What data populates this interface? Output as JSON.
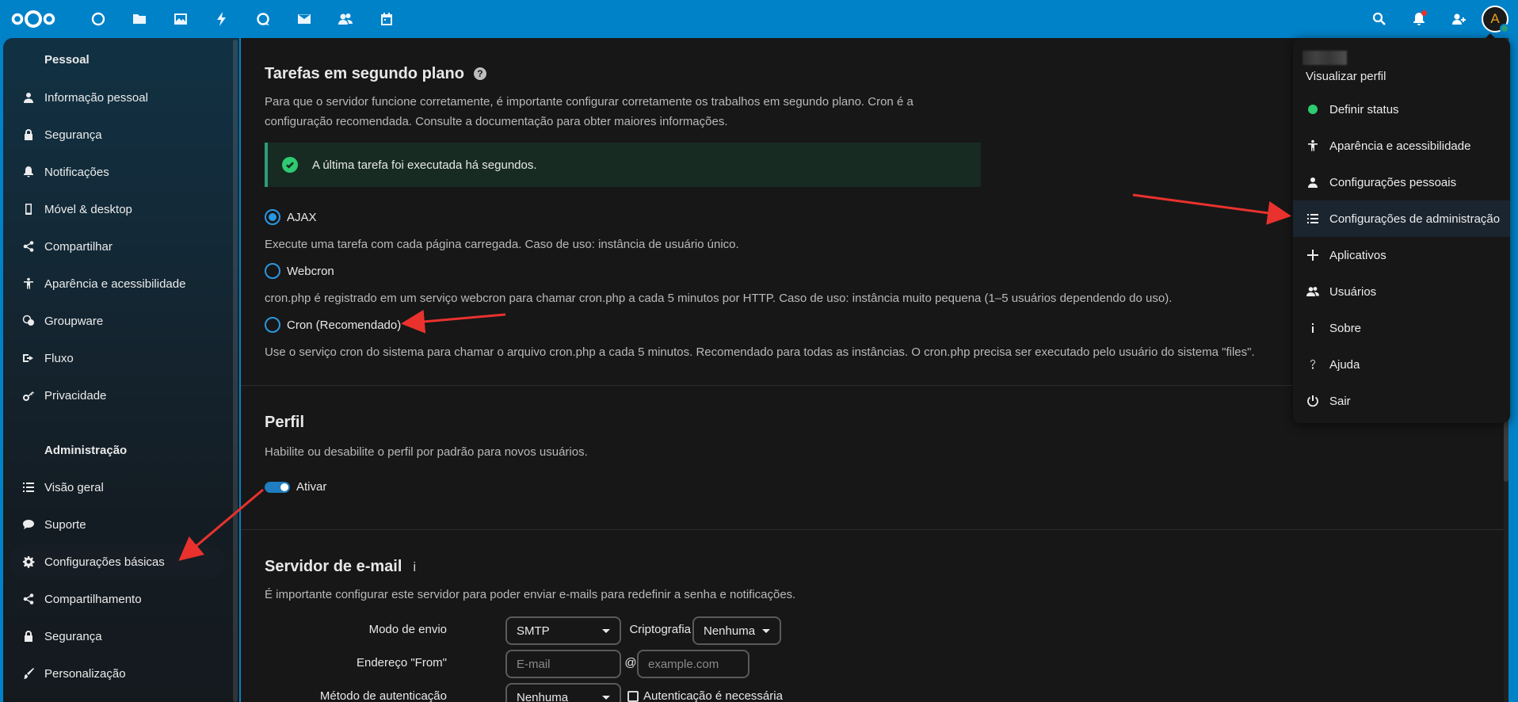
{
  "header": {
    "app_icons": [
      "dashboard-icon",
      "files-icon",
      "photos-icon",
      "activity-icon",
      "talk-icon",
      "mail-icon",
      "contacts-icon",
      "calendar-icon"
    ],
    "avatar_letter": "A"
  },
  "sidebar": {
    "personal_title": "Pessoal",
    "personal_items": [
      {
        "label": "Informação pessoal",
        "icon": "user-icon"
      },
      {
        "label": "Segurança",
        "icon": "lock-icon"
      },
      {
        "label": "Notificações",
        "icon": "bell-icon"
      },
      {
        "label": "Móvel & desktop",
        "icon": "phone-icon"
      },
      {
        "label": "Compartilhar",
        "icon": "share-icon"
      },
      {
        "label": "Aparência e acessibilidade",
        "icon": "accessibility-icon"
      },
      {
        "label": "Groupware",
        "icon": "groupware-icon"
      },
      {
        "label": "Fluxo",
        "icon": "flow-icon"
      },
      {
        "label": "Privacidade",
        "icon": "key-icon"
      }
    ],
    "admin_title": "Administração",
    "admin_items": [
      {
        "label": "Visão geral",
        "icon": "list-icon"
      },
      {
        "label": "Suporte",
        "icon": "chat-icon"
      },
      {
        "label": "Configurações básicas",
        "icon": "gear-icon",
        "active": true
      },
      {
        "label": "Compartilhamento",
        "icon": "share-icon"
      },
      {
        "label": "Segurança",
        "icon": "lock-icon"
      },
      {
        "label": "Personalização",
        "icon": "brush-icon"
      }
    ]
  },
  "background_jobs": {
    "title": "Tarefas em segundo plano",
    "description_line1": "Para que o servidor funcione corretamente, é importante configurar corretamente os trabalhos em segundo plano. Cron é a",
    "description_line2": "configuração recomendada. Consulte a documentação para obter maiores informações.",
    "status_message": "A última tarefa foi executada há segundos.",
    "options": [
      {
        "label": "AJAX",
        "checked": true,
        "description": "Execute uma tarefa com cada página carregada. Caso de uso: instância de usuário único."
      },
      {
        "label": "Webcron",
        "checked": false,
        "description": "cron.php é registrado em um serviço webcron para chamar cron.php a cada 5 minutos por HTTP. Caso de uso: instância muito pequena (1–5 usuários dependendo do uso)."
      },
      {
        "label": "Cron (Recomendado)",
        "checked": false,
        "description": "Use o serviço cron do sistema para chamar o arquivo cron.php a cada 5 minutos. Recomendado para todas as instâncias. O cron.php precisa ser executado pelo usuário do sistema \"files\"."
      }
    ]
  },
  "profile": {
    "title": "Perfil",
    "description": "Habilite ou desabilite o perfil por padrão para novos usuários.",
    "toggle_label": "Ativar",
    "enabled": true
  },
  "email": {
    "title": "Servidor de e-mail",
    "info": "i",
    "description": "É importante configurar este servidor para poder enviar e-mails para redefinir a senha e notificações.",
    "send_mode_label": "Modo de envio",
    "send_mode_value": "SMTP",
    "encryption_label": "Criptografia",
    "encryption_value": "Nenhuma",
    "from_label": "Endereço \"From\"",
    "from_placeholder": "E-mail",
    "at": "@",
    "domain_placeholder": "example.com",
    "auth_label": "Método de autenticação",
    "auth_value": "Nenhuma",
    "auth_required_label": "Autenticação é necessária"
  },
  "user_menu": {
    "view_profile": "Visualizar perfil",
    "items": [
      {
        "label": "Definir status",
        "icon": "status-dot"
      },
      {
        "label": "Aparência e acessibilidade",
        "icon": "accessibility-icon"
      },
      {
        "label": "Configurações pessoais",
        "icon": "user-icon"
      },
      {
        "label": "Configurações de administração",
        "icon": "admin-list-icon",
        "active": true
      },
      {
        "label": "Aplicativos",
        "icon": "plus-icon"
      },
      {
        "label": "Usuários",
        "icon": "users-icon"
      },
      {
        "label": "Sobre",
        "icon": "info-icon"
      },
      {
        "label": "Ajuda",
        "icon": "help-icon"
      },
      {
        "label": "Sair",
        "icon": "power-icon"
      }
    ]
  },
  "colors": {
    "brand": "#0082c9",
    "background": "#171717",
    "success": "#2ecb71",
    "accent": "#2b97e0",
    "annotation_arrow": "#e9322d"
  }
}
